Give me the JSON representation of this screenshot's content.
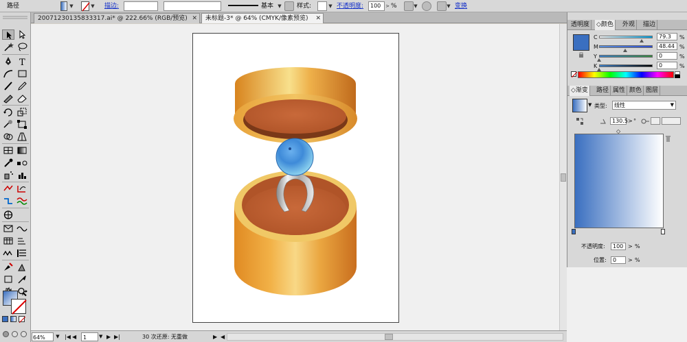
{
  "control_bar": {
    "object_type": "路径",
    "stroke_label": "描边:",
    "stroke_profile": "基本",
    "style_label": "样式:",
    "opacity_label": "不透明度:",
    "opacity_value": "100",
    "opacity_unit": "%",
    "transform_label": "变换"
  },
  "tabs": [
    {
      "label": "20071230135833317.ai* @ 222.66% (RGB/预览)",
      "active": false
    },
    {
      "label": "未标题-3* @ 64% (CMYK/像素预览)",
      "active": true
    }
  ],
  "status_bar": {
    "zoom": "64%",
    "page": "1",
    "message": "30 次还原: 无重做"
  },
  "color_panel": {
    "tabs": [
      {
        "label": "透明度",
        "active": false
      },
      {
        "label": "颜色",
        "active": true
      },
      {
        "label": "外观",
        "active": false
      },
      {
        "label": "描边",
        "active": false
      }
    ],
    "channels": [
      {
        "label": "C",
        "value": "79.3",
        "unit": "%",
        "fraction": 0.793,
        "from": "#ffffff",
        "to": "#00a0e0"
      },
      {
        "label": "M",
        "value": "48.44",
        "unit": "%",
        "fraction": 0.4844,
        "from": "#5a8ed8",
        "to": "#3050d0"
      },
      {
        "label": "Y",
        "value": "0",
        "unit": "%",
        "fraction": 0.0,
        "from": "#3a7ec8",
        "to": "#3a8a40"
      },
      {
        "label": "K",
        "value": "0",
        "unit": "%",
        "fraction": 0.0,
        "from": "#3a7ec8",
        "to": "#000000"
      }
    ],
    "swatch": "#3a6fc0"
  },
  "gradient_panel": {
    "tabs": [
      {
        "label": "渐变",
        "active": true
      },
      {
        "label": "路径",
        "active": false
      },
      {
        "label": "属性",
        "active": false
      },
      {
        "label": "颜色",
        "active": false
      },
      {
        "label": "图层",
        "active": false
      }
    ],
    "type_label": "类型:",
    "type_value": "线性",
    "angle_value": "130.5",
    "angle_unit": "°",
    "opacity_label": "不透明度:",
    "opacity_value": "100",
    "opacity_unit": "%",
    "location_label": "位置:",
    "location_value": "0",
    "location_unit": "%",
    "gradient_start": "#3a6fc0",
    "gradient_end": "#ffffff"
  },
  "colors": {
    "ring_gold_dark": "#d8841e",
    "ring_gold_light": "#f8e08c",
    "box_inside": "#b85a2c",
    "gem_blue": "#4aa0e6"
  }
}
